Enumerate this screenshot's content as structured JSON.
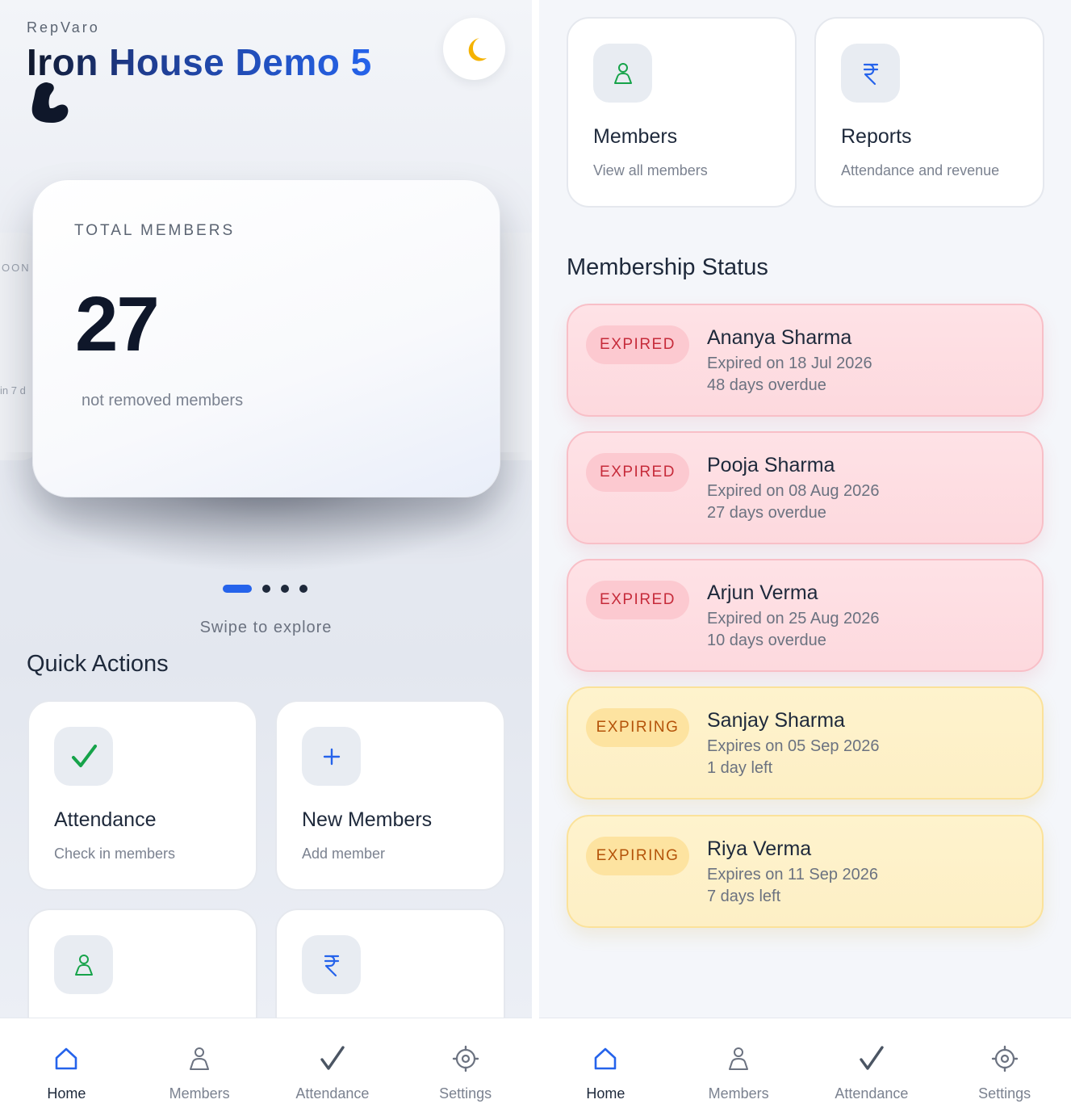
{
  "left": {
    "brand": "RepVaro",
    "gym_name": "Iron House Demo 5",
    "carousel": {
      "active_card": {
        "label": "TOTAL MEMBERS",
        "value": "27",
        "sub": "not removed members"
      },
      "peek_left_label": "OON",
      "peek_left_sub": "in 7 d",
      "dot_count": 4,
      "active_dot": 1
    },
    "swipe_hint": "Swipe to explore",
    "quick_actions_title": "Quick Actions",
    "actions": [
      {
        "title": "Attendance",
        "sub": "Check in members",
        "icon": "check-icon"
      },
      {
        "title": "New Members",
        "sub": "Add member",
        "icon": "plus-icon"
      },
      {
        "title": "",
        "sub": "",
        "icon": "member-icon"
      },
      {
        "title": "",
        "sub": "",
        "icon": "rupee-icon"
      }
    ]
  },
  "right": {
    "actions": [
      {
        "title": "Members",
        "sub": "View all members",
        "icon": "member-icon"
      },
      {
        "title": "Reports",
        "sub": "Attendance and revenue",
        "icon": "rupee-icon"
      }
    ],
    "membership_status_title": "Membership Status",
    "statuses": [
      {
        "state": "expired",
        "badge": "EXPIRED",
        "name": "Ananya Sharma",
        "date": "Expired on 18 Jul 2026",
        "remaining": "48 days overdue"
      },
      {
        "state": "expired",
        "badge": "EXPIRED",
        "name": "Pooja Sharma",
        "date": "Expired on 08 Aug 2026",
        "remaining": "27 days overdue"
      },
      {
        "state": "expired",
        "badge": "EXPIRED",
        "name": "Arjun Verma",
        "date": "Expired on 25 Aug 2026",
        "remaining": "10 days overdue"
      },
      {
        "state": "expiring",
        "badge": "EXPIRING",
        "name": "Sanjay Sharma",
        "date": "Expires on 05 Sep 2026",
        "remaining": "1 day left"
      },
      {
        "state": "expiring",
        "badge": "EXPIRING",
        "name": "Riya Verma",
        "date": "Expires on 11 Sep 2026",
        "remaining": "7 days left"
      }
    ]
  },
  "nav": {
    "items": [
      {
        "label": "Home",
        "icon": "home-icon",
        "active": true
      },
      {
        "label": "Members",
        "icon": "members-icon",
        "active": false
      },
      {
        "label": "Attendance",
        "icon": "attendance-icon",
        "active": false
      },
      {
        "label": "Settings",
        "icon": "settings-icon",
        "active": false
      }
    ]
  },
  "colors": {
    "accent": "#2563eb",
    "title_dark": "#1e3a8a",
    "check_green": "#16a34a",
    "member_green": "#16a34a",
    "expired_text": "#c62b3a",
    "expiring_text": "#b45309"
  }
}
